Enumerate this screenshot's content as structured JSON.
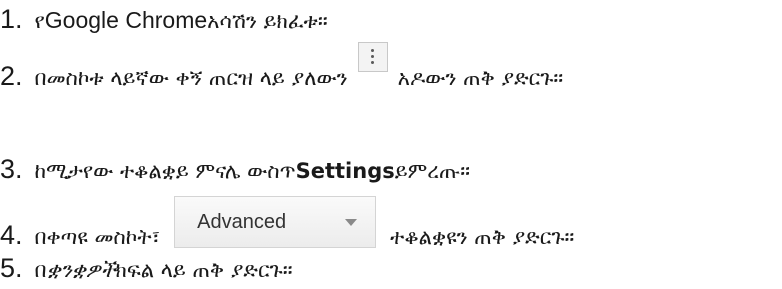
{
  "steps": [
    {
      "number": "1.",
      "prefix": "የ",
      "app_name": "Google Chrome",
      "suffix": " አሳሽን ይክፈቱ።"
    },
    {
      "number": "2.",
      "before": "በመስኮቱ ላይኛው ቀኝ ጠርዝ ላይ ያለውን",
      "after": "አዶውን ጠቅ ያድርጉ።",
      "icon": "vertical-ellipsis-menu-icon"
    },
    {
      "number": "3.",
      "before": "ከሚታየው ተቆልቋይ ምናሌ ውስጥ ",
      "keyword": "Settings",
      "after": " ይምረጡ።"
    },
    {
      "number": "4.",
      "before": "በቀጣዩ መስኮት፣",
      "button_label": "Advanced",
      "after": "ተቆልቋዩን ጠቅ ያድርጉ።"
    },
    {
      "number": "5.",
      "before": "በ ",
      "emphasis": "ቋንቋዎች",
      "after": " ክፍል ላይ ጠቅ ያድርጉ።"
    }
  ]
}
